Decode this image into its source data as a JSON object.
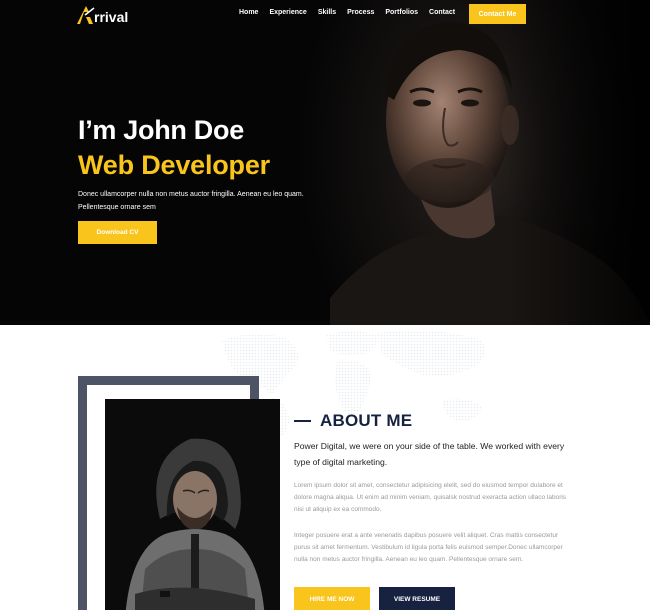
{
  "brand": {
    "logo_text": "rrival",
    "accent": "#f9c41b",
    "navy": "#16223f"
  },
  "nav": {
    "links": [
      "Home",
      "Experience",
      "Skills",
      "Process",
      "Portfolios",
      "Contact"
    ],
    "cta_label": "Contact Me"
  },
  "hero": {
    "name": "I’m John Doe",
    "role": "Web Developer",
    "description_line1": "Donec ullamcorper nulla non metus auctor fringilla. Aenean eu leo quam.",
    "description_line2": "Pellentesque ornare sem",
    "button_label": "Download CV"
  },
  "about": {
    "title": "ABOUT ME",
    "lead": "Power Digital, we were on your side of the table. We worked with every type of digital marketing.",
    "paragraph1": "Lorem ipsum dolor sit amet, consectetur adipisicing elelit, sed do eiusmod tempor dulabore et dolore magna aliqua. Ut enim ad minim veniam, quisalsk nostrud exeracta action ullaco laboris nisi ut aliquip ex ea commodo.",
    "paragraph2": "Integer posuere erat a ante venenatis dapibus posuere velit aliquet. Cras mattis consectetur purus sit amet fermentum. Vestibulum id ligula porta felis euismod semper.Donec ullamcorper nulla non metus auctor fringilla. Aenean eu leo quam. Pellentesque ornare sem.",
    "hire_label": "HIRE ME NOW",
    "resume_label": "VIEW RESUME"
  }
}
